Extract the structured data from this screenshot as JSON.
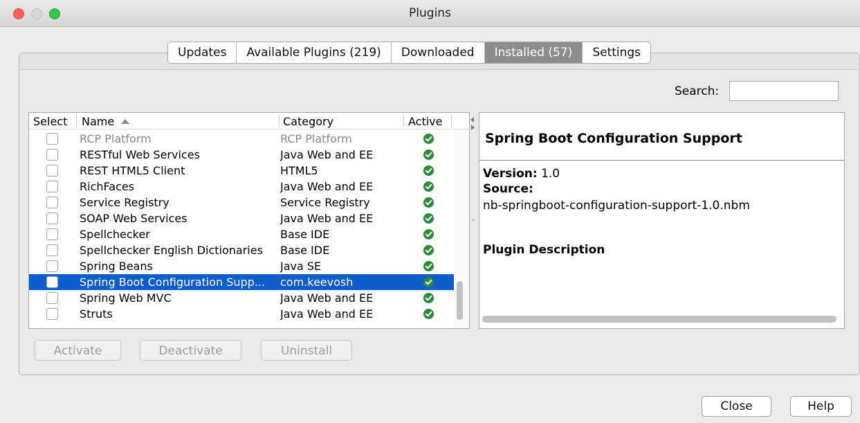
{
  "window": {
    "title": "Plugins"
  },
  "tabs": [
    {
      "label": "Updates",
      "active": false
    },
    {
      "label": "Available Plugins (219)",
      "active": false
    },
    {
      "label": "Downloaded",
      "active": false
    },
    {
      "label": "Installed (57)",
      "active": true
    },
    {
      "label": "Settings",
      "active": false
    }
  ],
  "search": {
    "label": "Search:",
    "value": ""
  },
  "table": {
    "columns": {
      "select": "Select",
      "name": "Name",
      "category": "Category",
      "active": "Active"
    },
    "sort": {
      "column": "Name",
      "direction": "ascending"
    },
    "rows": [
      {
        "name": "RCP Platform",
        "category": "RCP Platform",
        "active": true,
        "checked": false,
        "selected": false,
        "enabled": false
      },
      {
        "name": "RESTful Web Services",
        "category": "Java Web and EE",
        "active": true,
        "checked": false,
        "selected": false,
        "enabled": true
      },
      {
        "name": "REST HTML5 Client",
        "category": "HTML5",
        "active": true,
        "checked": false,
        "selected": false,
        "enabled": true
      },
      {
        "name": "RichFaces",
        "category": "Java Web and EE",
        "active": true,
        "checked": false,
        "selected": false,
        "enabled": true
      },
      {
        "name": "Service Registry",
        "category": "Service Registry",
        "active": true,
        "checked": false,
        "selected": false,
        "enabled": true
      },
      {
        "name": "SOAP Web Services",
        "category": "Java Web and EE",
        "active": true,
        "checked": false,
        "selected": false,
        "enabled": true
      },
      {
        "name": "Spellchecker",
        "category": "Base IDE",
        "active": true,
        "checked": false,
        "selected": false,
        "enabled": true
      },
      {
        "name": "Spellchecker English Dictionaries",
        "category": "Base IDE",
        "active": true,
        "checked": false,
        "selected": false,
        "enabled": true
      },
      {
        "name": "Spring Beans",
        "category": "Java SE",
        "active": true,
        "checked": false,
        "selected": false,
        "enabled": true
      },
      {
        "name": "Spring Boot Configuration Supp...",
        "category": "com.keevosh",
        "active": true,
        "checked": false,
        "selected": true,
        "enabled": true
      },
      {
        "name": "Spring Web MVC",
        "category": "Java Web and EE",
        "active": true,
        "checked": false,
        "selected": false,
        "enabled": true
      },
      {
        "name": "Struts",
        "category": "Java Web and EE",
        "active": true,
        "checked": false,
        "selected": false,
        "enabled": true
      }
    ]
  },
  "details": {
    "title": "Spring Boot Configuration Support",
    "version_label": "Version:",
    "version": "1.0",
    "source_label": "Source:",
    "source": "nb-springboot-configuration-support-1.0.nbm",
    "description_label": "Plugin Description"
  },
  "actions": {
    "activate": "Activate",
    "deactivate": "Deactivate",
    "uninstall": "Uninstall"
  },
  "footer": {
    "close": "Close",
    "help": "Help"
  },
  "colors": {
    "selection": "#0d5dcd",
    "active_tab": "#8d8d8d",
    "active_check": "#2d8a3a"
  }
}
